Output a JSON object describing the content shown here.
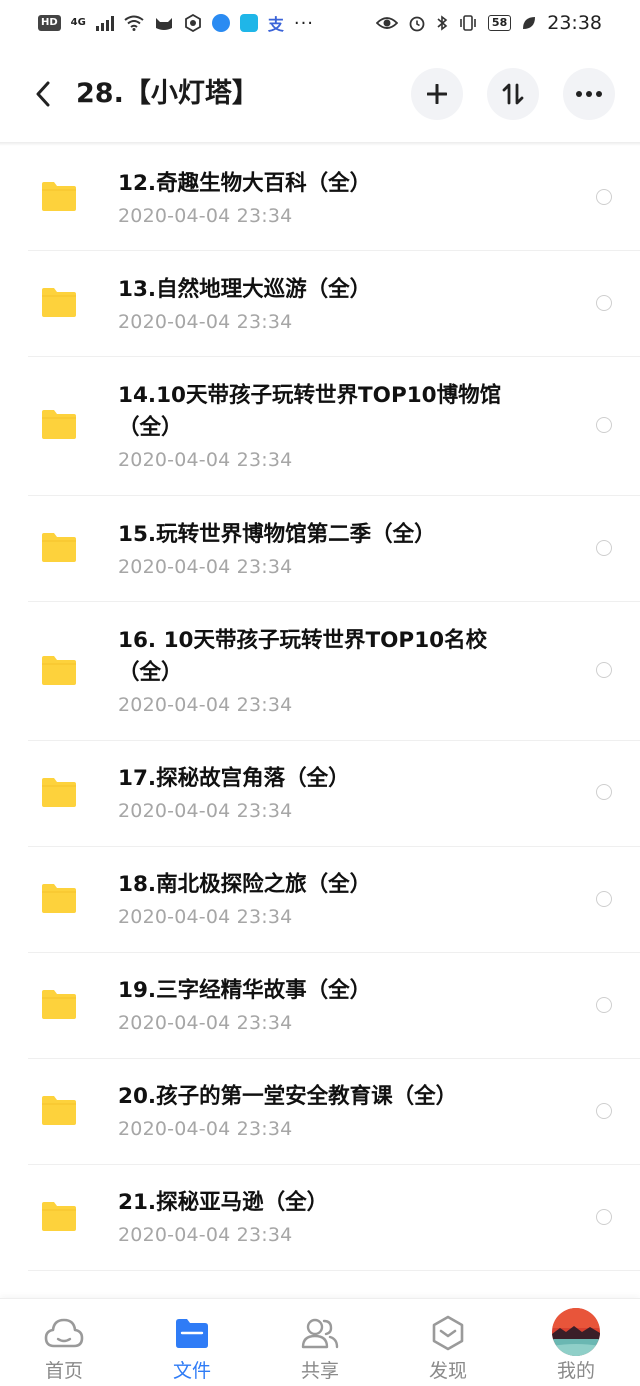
{
  "status_bar": {
    "hd": "HD",
    "network": "4G",
    "more": "···",
    "battery": "58",
    "time": "23:38",
    "app_text_icon": "支"
  },
  "header": {
    "title": "28.【小灯塔】",
    "back_icon": "chevron-left-icon",
    "add_icon": "plus-icon",
    "sort_icon": "sort-icon",
    "more_icon": "more-horizontal-icon"
  },
  "files": [
    {
      "name": "12.奇趣生物大百科（全）",
      "date": "2020-04-04  23:34"
    },
    {
      "name": "13.自然地理大巡游（全）",
      "date": "2020-04-04  23:34"
    },
    {
      "name": "14.10天带孩子玩转世界TOP10博物馆（全）",
      "date": "2020-04-04  23:34"
    },
    {
      "name": "15.玩转世界博物馆第二季（全）",
      "date": "2020-04-04  23:34"
    },
    {
      "name": "16. 10天带孩子玩转世界TOP10名校（全）",
      "date": "2020-04-04  23:34"
    },
    {
      "name": "17.探秘故宫角落（全）",
      "date": "2020-04-04  23:34"
    },
    {
      "name": "18.南北极探险之旅（全）",
      "date": "2020-04-04  23:34"
    },
    {
      "name": "19.三字经精华故事（全）",
      "date": "2020-04-04  23:34"
    },
    {
      "name": "20.孩子的第一堂安全教育课（全）",
      "date": "2020-04-04  23:34"
    },
    {
      "name": "21.探秘亚马逊（全）",
      "date": "2020-04-04  23:34"
    }
  ],
  "nav": {
    "items": [
      {
        "label": "首页",
        "icon": "cloud-icon",
        "active": false
      },
      {
        "label": "文件",
        "icon": "folder-icon",
        "active": true
      },
      {
        "label": "共享",
        "icon": "people-icon",
        "active": false
      },
      {
        "label": "发现",
        "icon": "discover-icon",
        "active": false
      },
      {
        "label": "我的",
        "icon": "avatar",
        "active": false
      }
    ]
  },
  "colors": {
    "folder": "#fdd23c",
    "accent": "#2f7cf6",
    "date": "#a6a6a6"
  }
}
